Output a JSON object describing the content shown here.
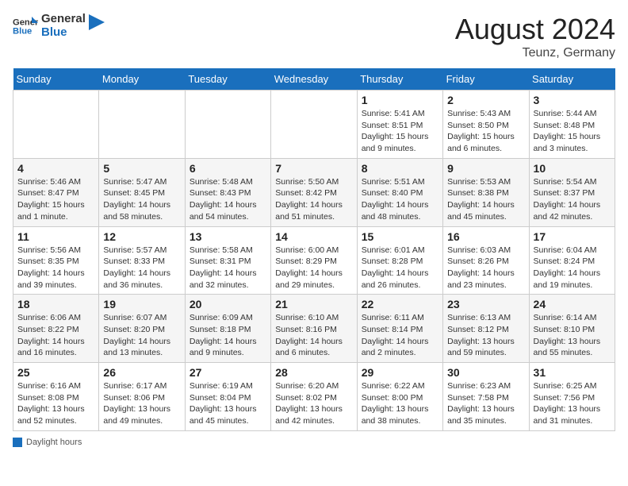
{
  "header": {
    "logo_line1": "General",
    "logo_line2": "Blue",
    "month_year": "August 2024",
    "location": "Teunz, Germany"
  },
  "weekdays": [
    "Sunday",
    "Monday",
    "Tuesday",
    "Wednesday",
    "Thursday",
    "Friday",
    "Saturday"
  ],
  "weeks": [
    [
      null,
      null,
      null,
      null,
      {
        "day": 1,
        "sunrise": "5:41 AM",
        "sunset": "8:51 PM",
        "daylight": "15 hours and 9 minutes."
      },
      {
        "day": 2,
        "sunrise": "5:43 AM",
        "sunset": "8:50 PM",
        "daylight": "15 hours and 6 minutes."
      },
      {
        "day": 3,
        "sunrise": "5:44 AM",
        "sunset": "8:48 PM",
        "daylight": "15 hours and 3 minutes."
      }
    ],
    [
      {
        "day": 4,
        "sunrise": "5:46 AM",
        "sunset": "8:47 PM",
        "daylight": "15 hours and 1 minute."
      },
      {
        "day": 5,
        "sunrise": "5:47 AM",
        "sunset": "8:45 PM",
        "daylight": "14 hours and 58 minutes."
      },
      {
        "day": 6,
        "sunrise": "5:48 AM",
        "sunset": "8:43 PM",
        "daylight": "14 hours and 54 minutes."
      },
      {
        "day": 7,
        "sunrise": "5:50 AM",
        "sunset": "8:42 PM",
        "daylight": "14 hours and 51 minutes."
      },
      {
        "day": 8,
        "sunrise": "5:51 AM",
        "sunset": "8:40 PM",
        "daylight": "14 hours and 48 minutes."
      },
      {
        "day": 9,
        "sunrise": "5:53 AM",
        "sunset": "8:38 PM",
        "daylight": "14 hours and 45 minutes."
      },
      {
        "day": 10,
        "sunrise": "5:54 AM",
        "sunset": "8:37 PM",
        "daylight": "14 hours and 42 minutes."
      }
    ],
    [
      {
        "day": 11,
        "sunrise": "5:56 AM",
        "sunset": "8:35 PM",
        "daylight": "14 hours and 39 minutes."
      },
      {
        "day": 12,
        "sunrise": "5:57 AM",
        "sunset": "8:33 PM",
        "daylight": "14 hours and 36 minutes."
      },
      {
        "day": 13,
        "sunrise": "5:58 AM",
        "sunset": "8:31 PM",
        "daylight": "14 hours and 32 minutes."
      },
      {
        "day": 14,
        "sunrise": "6:00 AM",
        "sunset": "8:29 PM",
        "daylight": "14 hours and 29 minutes."
      },
      {
        "day": 15,
        "sunrise": "6:01 AM",
        "sunset": "8:28 PM",
        "daylight": "14 hours and 26 minutes."
      },
      {
        "day": 16,
        "sunrise": "6:03 AM",
        "sunset": "8:26 PM",
        "daylight": "14 hours and 23 minutes."
      },
      {
        "day": 17,
        "sunrise": "6:04 AM",
        "sunset": "8:24 PM",
        "daylight": "14 hours and 19 minutes."
      }
    ],
    [
      {
        "day": 18,
        "sunrise": "6:06 AM",
        "sunset": "8:22 PM",
        "daylight": "14 hours and 16 minutes."
      },
      {
        "day": 19,
        "sunrise": "6:07 AM",
        "sunset": "8:20 PM",
        "daylight": "14 hours and 13 minutes."
      },
      {
        "day": 20,
        "sunrise": "6:09 AM",
        "sunset": "8:18 PM",
        "daylight": "14 hours and 9 minutes."
      },
      {
        "day": 21,
        "sunrise": "6:10 AM",
        "sunset": "8:16 PM",
        "daylight": "14 hours and 6 minutes."
      },
      {
        "day": 22,
        "sunrise": "6:11 AM",
        "sunset": "8:14 PM",
        "daylight": "14 hours and 2 minutes."
      },
      {
        "day": 23,
        "sunrise": "6:13 AM",
        "sunset": "8:12 PM",
        "daylight": "13 hours and 59 minutes."
      },
      {
        "day": 24,
        "sunrise": "6:14 AM",
        "sunset": "8:10 PM",
        "daylight": "13 hours and 55 minutes."
      }
    ],
    [
      {
        "day": 25,
        "sunrise": "6:16 AM",
        "sunset": "8:08 PM",
        "daylight": "13 hours and 52 minutes."
      },
      {
        "day": 26,
        "sunrise": "6:17 AM",
        "sunset": "8:06 PM",
        "daylight": "13 hours and 49 minutes."
      },
      {
        "day": 27,
        "sunrise": "6:19 AM",
        "sunset": "8:04 PM",
        "daylight": "13 hours and 45 minutes."
      },
      {
        "day": 28,
        "sunrise": "6:20 AM",
        "sunset": "8:02 PM",
        "daylight": "13 hours and 42 minutes."
      },
      {
        "day": 29,
        "sunrise": "6:22 AM",
        "sunset": "8:00 PM",
        "daylight": "13 hours and 38 minutes."
      },
      {
        "day": 30,
        "sunrise": "6:23 AM",
        "sunset": "7:58 PM",
        "daylight": "13 hours and 35 minutes."
      },
      {
        "day": 31,
        "sunrise": "6:25 AM",
        "sunset": "7:56 PM",
        "daylight": "13 hours and 31 minutes."
      }
    ]
  ],
  "footer": {
    "daylight_label": "Daylight hours"
  }
}
